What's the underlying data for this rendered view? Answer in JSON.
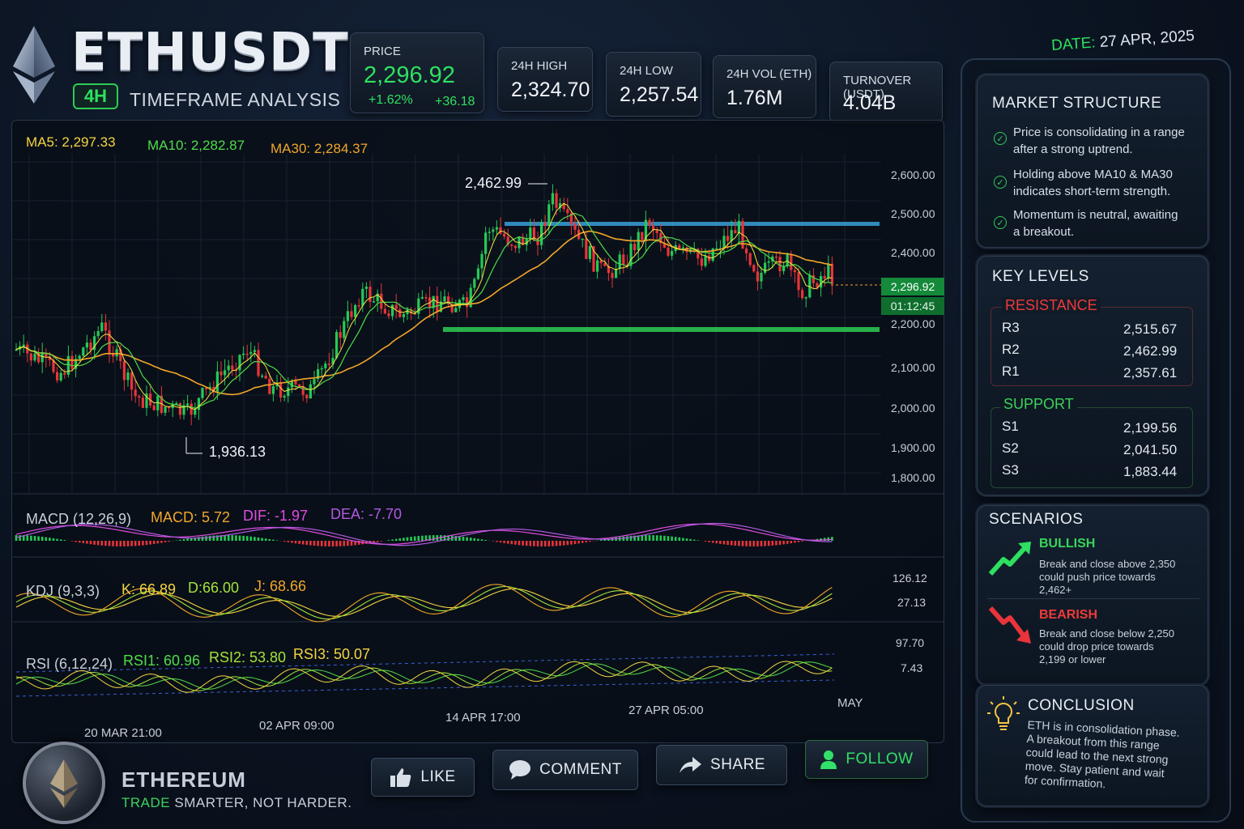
{
  "header": {
    "symbol": "ETHUSDT",
    "timeframe": "4H",
    "timeframe_label": "TIMEFRAME ANALYSIS",
    "date_label": "DATE:",
    "date_value": "27 APR, 2025"
  },
  "stats": {
    "price_label": "PRICE",
    "price_value": "2,296.92",
    "price_change_pct": "+1.62%",
    "price_change_abs": "+36.18",
    "high_label": "24H HIGH",
    "high_value": "2,324.70",
    "low_label": "24H LOW",
    "low_value": "2,257.54",
    "vol_label": "24H VOL (ETH)",
    "vol_value": "1.76M",
    "turnover_label": "TURNOVER (USDT)",
    "turnover_value": "4.04B"
  },
  "chart": {
    "ma5": "MA5: 2,297.33",
    "ma10": "MA10: 2,282.87",
    "ma30": "MA30: 2,284.37",
    "high_marker": "2,462.99",
    "low_marker": "1,936.13",
    "y_ticks": [
      "2,600.00",
      "2,500.00",
      "2,400.00",
      "2,200.00",
      "2,100.00",
      "2,000.00",
      "1,900.00",
      "1,800.00"
    ],
    "current_price_tag": "2,296.92",
    "countdown_tag": "01:12:45",
    "x_ticks": [
      "20 MAR 21:00",
      "02 APR 09:00",
      "14 APR 17:00",
      "27 APR 05:00",
      "MAY"
    ],
    "colors": {
      "up": "#26c957",
      "down": "#e8343a",
      "ma5": "#f5e642",
      "ma10": "#4fdc4a",
      "ma30": "#f2a62a",
      "resistance": "#3aa0d8",
      "support": "#2ecc55"
    }
  },
  "indicators": {
    "macd": {
      "name": "MACD (12,26,9)",
      "macd": "MACD: 5.72",
      "dif": "DIF: -1.97",
      "dea": "DEA: -7.70"
    },
    "kdj": {
      "name": "KDJ (9,3,3)",
      "k": "K: 66.89",
      "d": "D:66.00",
      "j": "J: 68.66",
      "axis_top": "126.12",
      "axis_bottom": "27.13"
    },
    "rsi": {
      "name": "RSI (6,12,24)",
      "rsi1": "RSI1: 60.96",
      "rsi2": "RSI2: 53.80",
      "rsi3": "RSI3: 50.07",
      "axis_top": "97.70",
      "axis_bottom": "7.43"
    }
  },
  "market_structure": {
    "title": "MARKET STRUCTURE",
    "items": [
      [
        "Price is consolidating in a range",
        "after a strong uptrend."
      ],
      [
        "Holding above MA10 & MA30",
        "indicates short-term strength."
      ],
      [
        "Momentum is neutral, awaiting",
        "a breakout."
      ]
    ]
  },
  "key_levels": {
    "title": "KEY  LEVELS",
    "resistance_label": "RESISTANCE",
    "resistance": [
      {
        "name": "R3",
        "value": "2,515.67"
      },
      {
        "name": "R2",
        "value": "2,462.99"
      },
      {
        "name": "R1",
        "value": "2,357.61"
      }
    ],
    "support_label": "SUPPORT",
    "support": [
      {
        "name": "S1",
        "value": "2,199.56"
      },
      {
        "name": "S2",
        "value": "2,041.50"
      },
      {
        "name": "S3",
        "value": "1,883.44"
      }
    ]
  },
  "scenarios": {
    "title": "SCENARIOS",
    "bullish_label": "BULLISH",
    "bullish_text": [
      "Break and close above 2,350",
      "could push price towards",
      "2,462+"
    ],
    "bearish_label": "BEARISH",
    "bearish_text": [
      "Break and close below 2,250",
      "could drop price towards",
      "2,199 or lower"
    ]
  },
  "conclusion": {
    "title": "CONCLUSION",
    "text": [
      "ETH is in consolidation phase.",
      "A breakout from this range",
      "could lead to the next strong",
      "move. Stay patient and wait",
      "for confirmation."
    ]
  },
  "footer": {
    "brand": "ETHEREUM",
    "tagline_a": "TRADE",
    "tagline_b": "SMARTER, NOT HARDER.",
    "like": "LIKE",
    "comment": "COMMENT",
    "share": "SHARE",
    "follow": "FOLLOW"
  }
}
